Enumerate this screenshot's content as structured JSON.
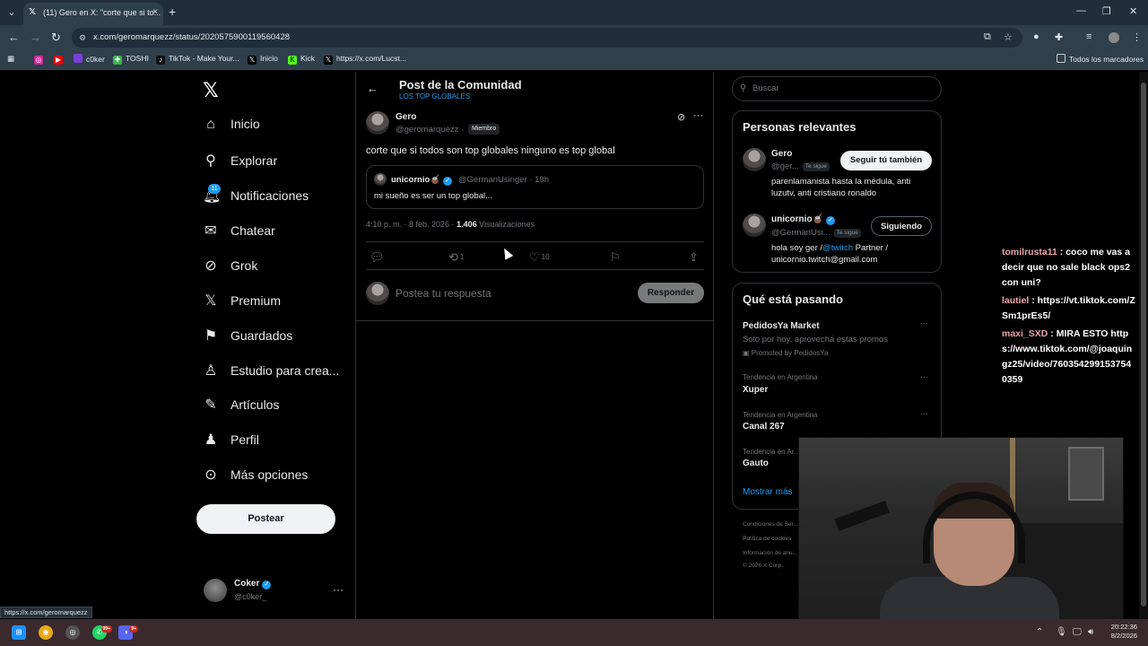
{
  "browser": {
    "tab_title": "(11) Gero en X: \"corte que si to...",
    "tab_close": "×",
    "new_tab": "+",
    "url": "x.com/geromarquezz/status/2020575900119560428",
    "bookmarks": [
      "c0ker",
      "TOSHI",
      "TikTok - Make Your...",
      "Inicio",
      "Kick",
      "https://x.com/Lucst..."
    ],
    "all_bookmarks": "Todos los marcadores"
  },
  "nav": {
    "items": [
      "Inicio",
      "Explorar",
      "Notificaciones",
      "Chatear",
      "Grok",
      "Premium",
      "Guardados",
      "Estudio para crea...",
      "Artículos",
      "Perfil",
      "Más opciones"
    ],
    "notif_badge": "11",
    "post_button": "Postear"
  },
  "account": {
    "name": "Coker",
    "handle": "@c0ker_"
  },
  "post": {
    "header_title": "Post de la Comunidad",
    "header_sub": "LOS TOP GLOBALES",
    "author_name": "Gero",
    "author_handle": "@geromarquezz ·",
    "member_badge": "Miembro",
    "text": "corte que si todos son top globales ninguno es top global",
    "quote_name": "unicornio🧉",
    "quote_handle": "@GermanUsinger · 19h",
    "quote_text": "mi sueño es ser un top global...",
    "time": "4:10 p. m. · 8 feb. 2026 ·",
    "views": "1.406",
    "views_label": "Visualizaciones",
    "retweets": "1",
    "likes": "10",
    "reply_placeholder": "Postea tu respuesta",
    "reply_button": "Responder"
  },
  "sidebar": {
    "search_placeholder": "Buscar",
    "relevant_title": "Personas relevantes",
    "people": [
      {
        "name": "Gero",
        "handle": "@ger...",
        "follows_you": "Te sigue",
        "button": "Seguir tú también",
        "bio": "parenlamanista hasta la médula, anti luzutv, anti cristiano ronaldo"
      },
      {
        "name": "unicornio🧉",
        "handle": "@GermanUsi...",
        "follows_you": "Te sigue",
        "button": "Siguiendo",
        "bio_pre": "hola soy ger /",
        "bio_link": "@twitch",
        "bio_post": " Partner / unicornio.twitch@gmail.com"
      }
    ],
    "trending_title": "Qué está pasando",
    "trends": [
      {
        "title": "PedidosYa Market",
        "desc": "Solo por hoy, aprovechá estas promos",
        "promo": "Promoted by PedidosYa"
      },
      {
        "context": "Tendencia en Argentina",
        "title": "Xuper"
      },
      {
        "context": "Tendencia en Argentina",
        "title": "Canal 267"
      },
      {
        "context": "Tendencia en Ar...",
        "title": "Gauto"
      }
    ],
    "show_more": "Mostrar más",
    "footer": [
      "Condiciones de Ser...",
      "Política de cookies",
      "Información de anu...",
      "© 2026 X Corp."
    ]
  },
  "chat": [
    {
      "user": "tomilrusta11",
      "msg": ": coco me vas a decir que no sale black ops2 con uni?"
    },
    {
      "user": "lautiel",
      "msg": ": https://vt.tiktok.com/ZSm1prEs5/"
    },
    {
      "user": "maxi_SXD",
      "msg": ": MIRA ESTO https://www.tiktok.com/@joaquingz25/video/7603542991537540359"
    }
  ],
  "status_url": "https://x.com/geromarquezz",
  "taskbar": {
    "time": "20:22:36",
    "date": "8/2/2026",
    "badge_whatsapp": "99+",
    "badge_discord": "9+"
  },
  "colors": {
    "accent": "#1d9bf0",
    "bg": "#000000",
    "border": "#2f3336",
    "muted": "#71767b"
  }
}
